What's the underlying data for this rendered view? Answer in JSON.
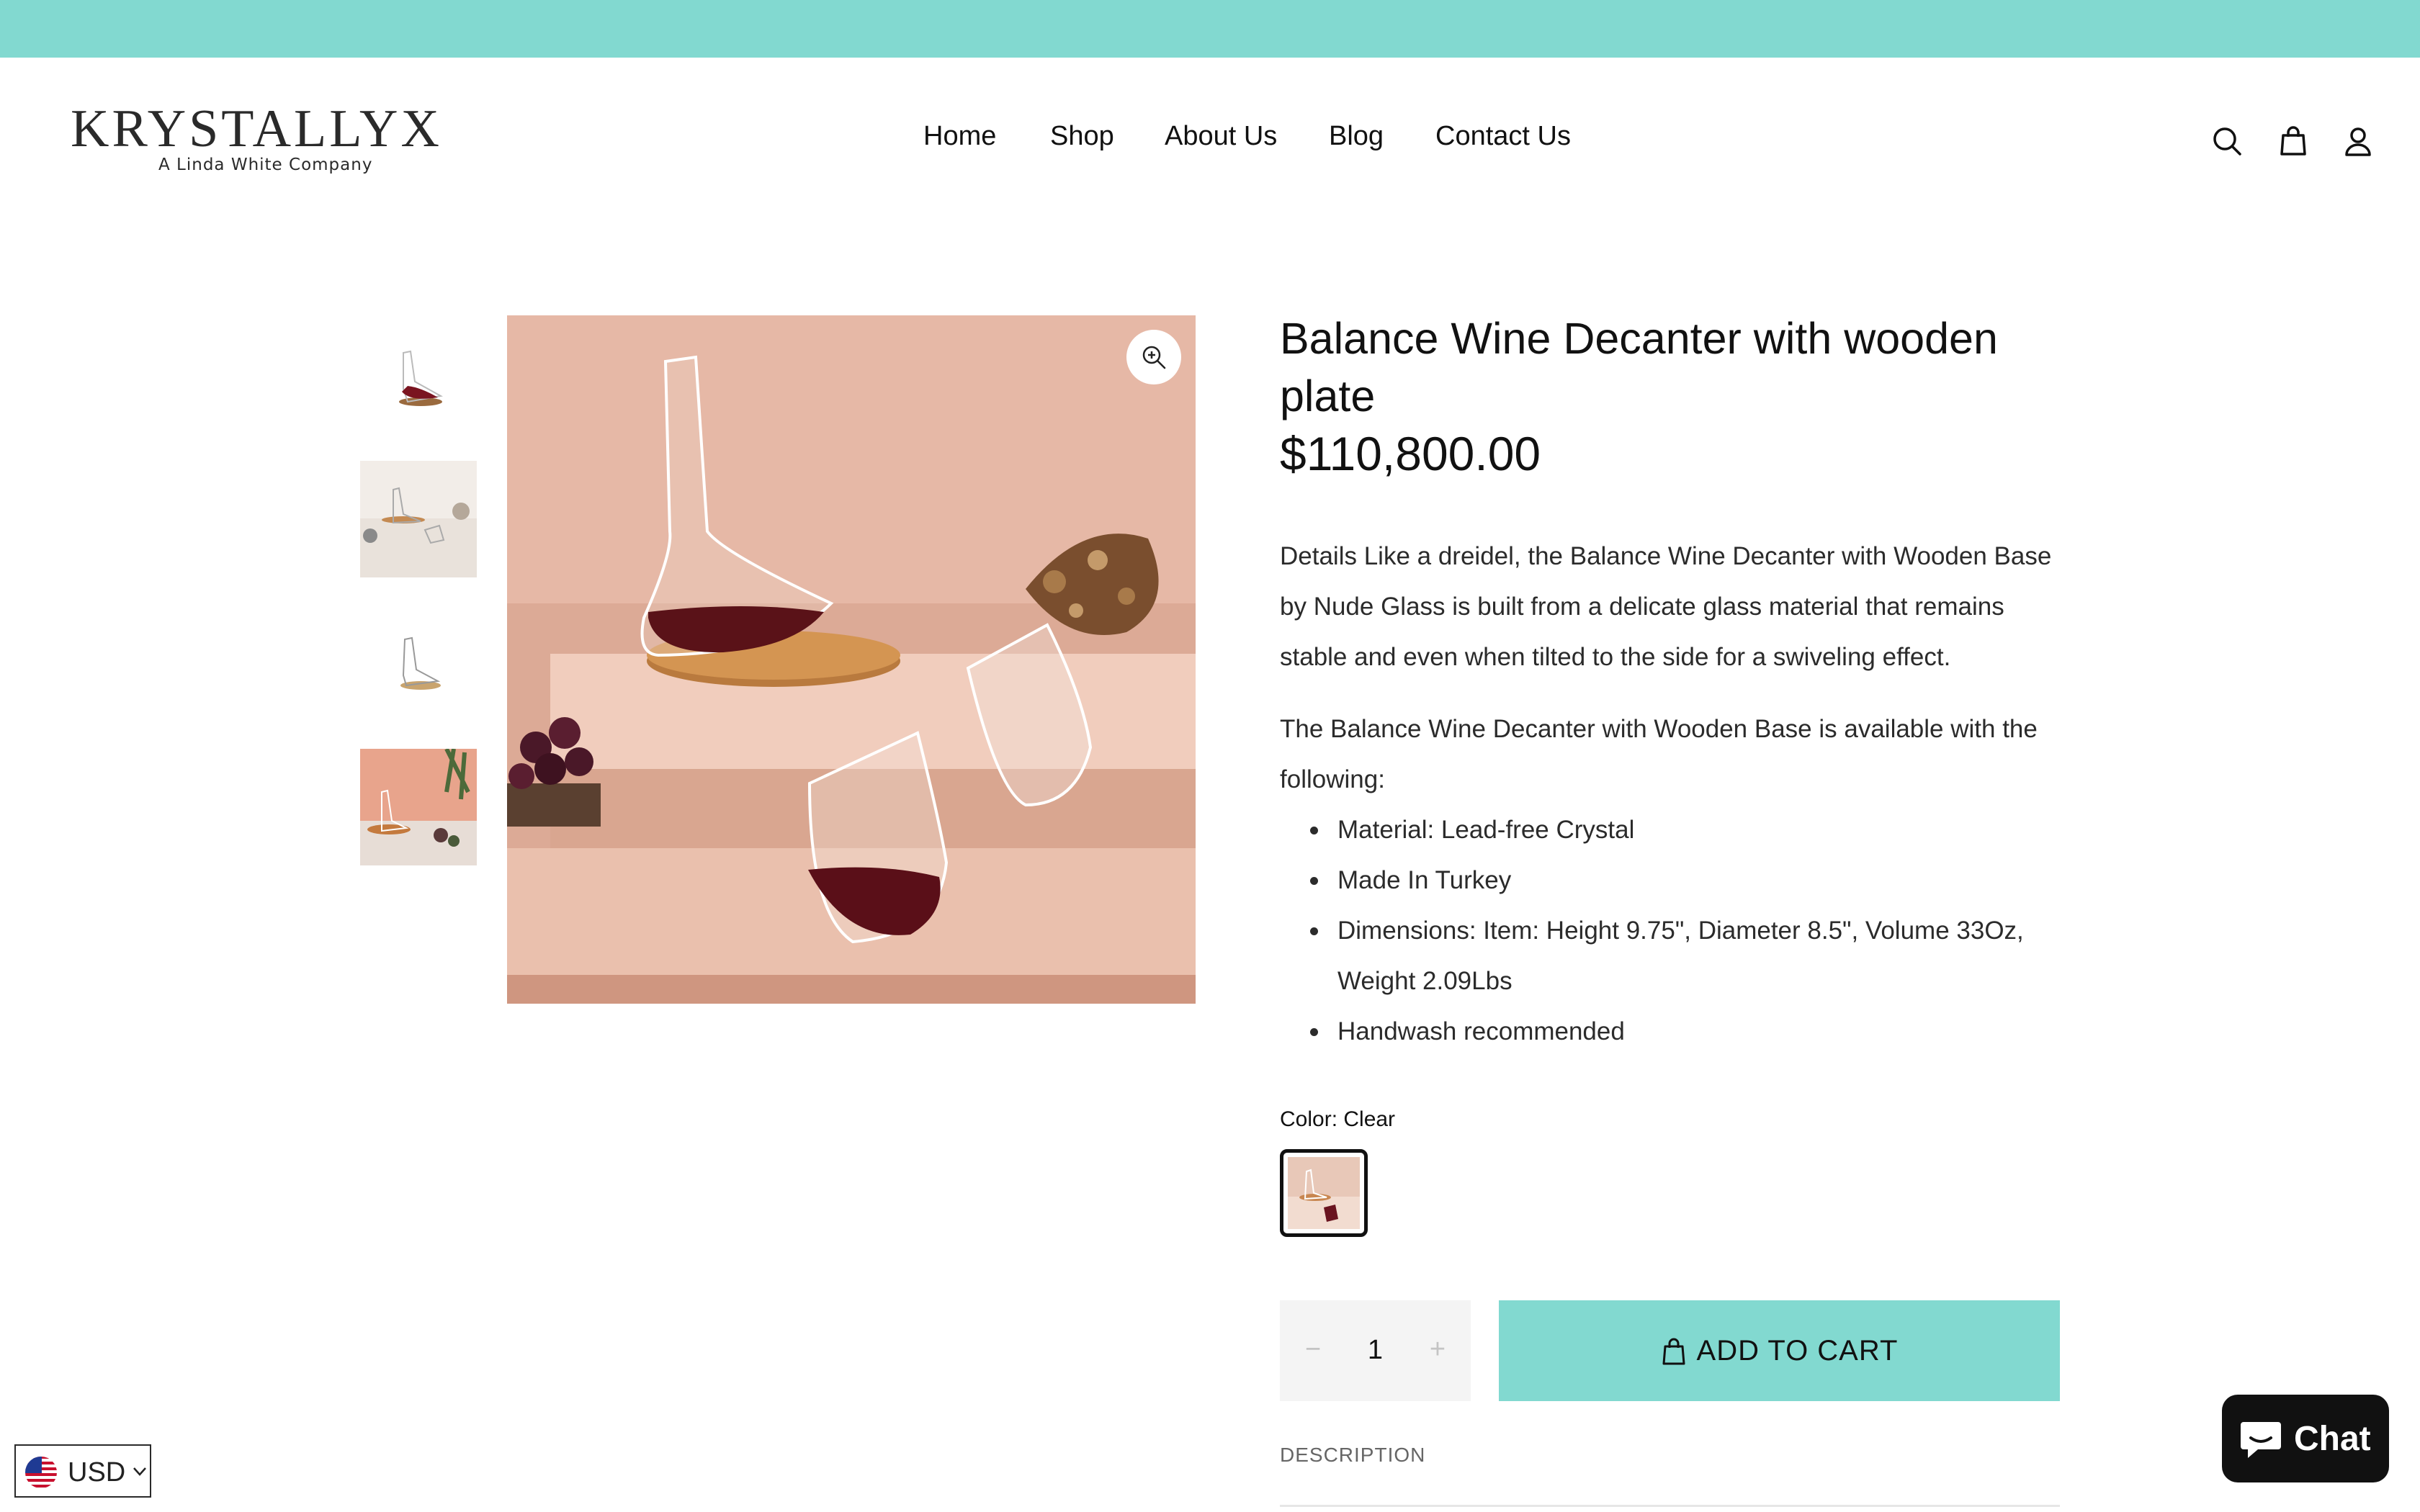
{
  "header": {
    "logo_text": "KRYSTALLYX",
    "logo_tagline": "A Linda White Company",
    "nav": [
      "Home",
      "Shop",
      "About Us",
      "Blog",
      "Contact Us"
    ]
  },
  "product": {
    "title": "Balance Wine Decanter with wooden plate",
    "price": "$110,800.00",
    "description_p1": "Details Like a dreidel, the Balance Wine Decanter with Wooden Base by Nude Glass is built from a delicate glass material that remains stable and even when tilted to the side for a swiveling effect.",
    "description_p2": "The Balance Wine Decanter with Wooden Base is available with the following:",
    "features": [
      "Material: Lead-free Crystal",
      "Made In Turkey",
      "Dimensions: Item: Height 9.75\", Diameter 8.5\", Volume 33Oz, Weight 2.09Lbs",
      "Handwash recommended"
    ],
    "color_label": "Color: Clear",
    "quantity": "1",
    "add_to_cart": "ADD TO CART",
    "description_tab": "DESCRIPTION"
  },
  "widgets": {
    "currency": "USD",
    "chat": "Chat"
  },
  "colors": {
    "accent": "#82d9d0",
    "text": "#111111"
  },
  "icons": [
    "search-icon",
    "cart-icon",
    "account-icon",
    "zoom-icon",
    "bag-icon",
    "us-flag-icon",
    "chevron-down-icon",
    "chat-bubble-icon"
  ]
}
